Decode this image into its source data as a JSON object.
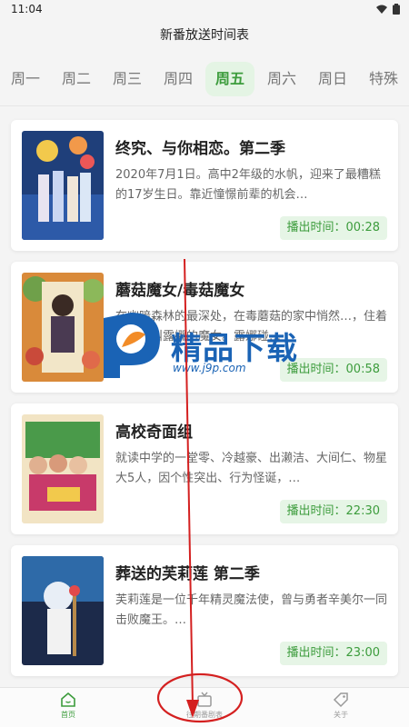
{
  "status_bar": {
    "time": "11:04"
  },
  "header": {
    "title": "新番放送时间表"
  },
  "tabs": [
    {
      "label": "周一"
    },
    {
      "label": "周二"
    },
    {
      "label": "周三"
    },
    {
      "label": "周四"
    },
    {
      "label": "周五",
      "active": true
    },
    {
      "label": "周六"
    },
    {
      "label": "周日"
    },
    {
      "label": "特殊"
    }
  ],
  "cards": [
    {
      "title": "终究、与你相恋。第二季",
      "desc": "2020年7月1日。高中2年级的水帆，迎来了最糟糕的17岁生日。靠近憧憬前辈的机会…",
      "time": "播出时间：00:28"
    },
    {
      "title": "蘑菇魔女/毒菇魔女",
      "desc": "在幽暗森林的最深处，在毒蘑菇的家中悄然…，住着一位名叫露娜的魔女。露娜碰…",
      "time": "播出时间：00:58"
    },
    {
      "title": "高校奇面组",
      "desc": "就读中学的一堂零、冷越豪、出濑洁、大间仁、物星大5人，因个性突出、行为怪诞，…",
      "time": "播出时间：22:30"
    },
    {
      "title": "葬送的芙莉莲 第二季",
      "desc": "芙莉莲是一位千年精灵魔法使，曾与勇者辛美尔一同击败魔王。…",
      "time": "播出时间：23:00"
    }
  ],
  "bottom_nav": [
    {
      "label": "首页",
      "icon": "home-icon",
      "active": true
    },
    {
      "label": "往期番剧表",
      "icon": "tv-icon"
    },
    {
      "label": "关于",
      "icon": "tag-icon"
    }
  ],
  "watermark": {
    "text": "精品下载",
    "url": "www.j9p.com"
  },
  "colors": {
    "accent": "#3c9c3c",
    "accent_bg": "#e4f4e4",
    "annotation": "#d42020",
    "watermark": "#1a63b5"
  }
}
